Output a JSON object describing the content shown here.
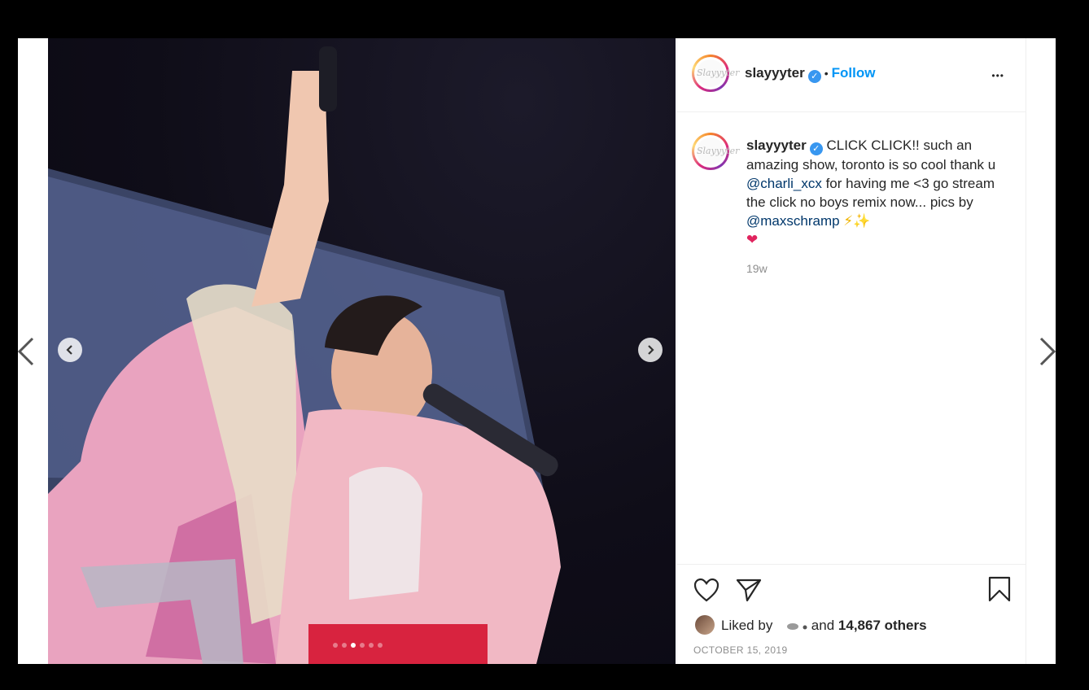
{
  "post": {
    "username": "slayyyter",
    "follow_label": "Follow",
    "separator": "•",
    "more_label": "•••",
    "avatar_logo_text": "Slayyyter",
    "caption_parts": [
      " CLICK CLICK!! such an amazing show, toronto is so cool thank u ",
      "@charli_xcx",
      " for having me <3 go stream the click no boys remix now... pics by ",
      "@maxschramp",
      " ⚡✨"
    ],
    "caption_heart": "❤",
    "time_ago": "19w",
    "liked_prefix": "Liked by",
    "liked_mid": "and",
    "liked_count": "14,867 others",
    "date": "OCTOBER 15, 2019"
  },
  "carousel": {
    "slide_count": 6,
    "active_index": 2
  },
  "colors": {
    "follow": "#0095f6",
    "verified": "#3897f0",
    "mention": "#00376b",
    "muted": "#8e8e8e",
    "backdrop": "#000000"
  },
  "icons": [
    "chevron-left-icon",
    "chevron-right-icon",
    "heart-icon",
    "share-icon",
    "bookmark-icon",
    "more-icon",
    "verified-icon"
  ]
}
